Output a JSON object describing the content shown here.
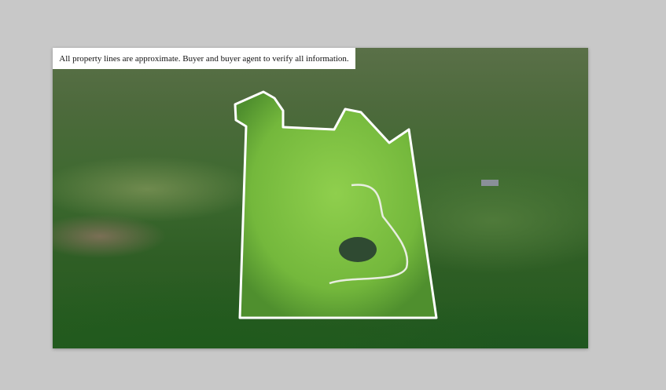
{
  "banner": {
    "text": "All property lines are approximate. Buyer and buyer agent to verify all information."
  },
  "colors": {
    "boundary": "#ffffff",
    "parcel_fill": "#7cc440",
    "background": "#c8c8c8"
  }
}
